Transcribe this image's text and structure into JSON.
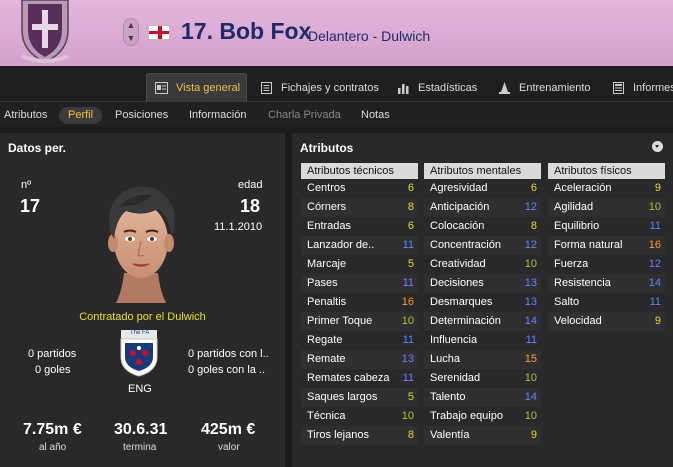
{
  "header": {
    "player_name": "17. Bob Fox",
    "position_club": "Delantero - Dulwich",
    "nation_flag": "england-flag-icon"
  },
  "tabs": [
    {
      "label": "Vista general",
      "icon": "overview-icon",
      "active": true
    },
    {
      "label": "Fichajes y contratos",
      "icon": "document-icon"
    },
    {
      "label": "Estadísticas",
      "icon": "bar-chart-icon"
    },
    {
      "label": "Entrenamiento",
      "icon": "cone-icon"
    },
    {
      "label": "Informes",
      "icon": "report-icon"
    }
  ],
  "subnav": [
    "Atributos",
    "Perfil",
    "Posiciones",
    "Información",
    "Charla Privada",
    "Notas"
  ],
  "subnav_active": "Perfil",
  "personal": {
    "title": "Datos per.",
    "number_label": "nº",
    "number": "17",
    "age_label": "edad",
    "age": "18",
    "dob": "11.1.2010",
    "contract": "Contratado por el Dulwich",
    "left_games": "0 partidos",
    "left_goals": "0 goles",
    "right_games": "0 partidos con l..",
    "right_goals": "0 goles con la ..",
    "fa_text": "The FA",
    "nation_code": "ENG",
    "wage_value": "7.75m €",
    "wage_label": "al año",
    "expires_value": "30.6.31",
    "expires_label": "termina",
    "value_value": "425m €",
    "value_label": "valor"
  },
  "attributes": {
    "title": "Atributos",
    "colors": {
      "green": "#a8c93a",
      "yellow": "#e8d92c",
      "blue": "#6e7fff",
      "orange": "#ff9d2a"
    },
    "technical": {
      "header": "Atributos técnicos",
      "items": [
        {
          "name": "Centros",
          "value": "6",
          "color": "yellow"
        },
        {
          "name": "Córners",
          "value": "8",
          "color": "yellow"
        },
        {
          "name": "Entradas",
          "value": "6",
          "color": "yellow"
        },
        {
          "name": "Lanzador de..",
          "value": "11",
          "color": "blue"
        },
        {
          "name": "Marcaje",
          "value": "5",
          "color": "yellow"
        },
        {
          "name": "Pases",
          "value": "11",
          "color": "blue"
        },
        {
          "name": "Penaltis",
          "value": "16",
          "color": "orange"
        },
        {
          "name": "Primer Toque",
          "value": "10",
          "color": "green"
        },
        {
          "name": "Regate",
          "value": "11",
          "color": "blue"
        },
        {
          "name": "Remate",
          "value": "13",
          "color": "blue"
        },
        {
          "name": "Remates cabeza",
          "value": "11",
          "color": "blue"
        },
        {
          "name": "Saques largos",
          "value": "5",
          "color": "yellow"
        },
        {
          "name": "Técnica",
          "value": "10",
          "color": "green"
        },
        {
          "name": "Tiros lejanos",
          "value": "8",
          "color": "yellow"
        }
      ]
    },
    "mental": {
      "header": "Atributos mentales",
      "items": [
        {
          "name": "Agresividad",
          "value": "6",
          "color": "yellow"
        },
        {
          "name": "Anticipación",
          "value": "12",
          "color": "blue"
        },
        {
          "name": "Colocación",
          "value": "8",
          "color": "yellow"
        },
        {
          "name": "Concentración",
          "value": "12",
          "color": "blue"
        },
        {
          "name": "Creatividad",
          "value": "10",
          "color": "green"
        },
        {
          "name": "Decisiones",
          "value": "13",
          "color": "blue"
        },
        {
          "name": "Desmarques",
          "value": "13",
          "color": "blue"
        },
        {
          "name": "Determinación",
          "value": "14",
          "color": "blue"
        },
        {
          "name": "Influencia",
          "value": "11",
          "color": "blue"
        },
        {
          "name": "Lucha",
          "value": "15",
          "color": "orange"
        },
        {
          "name": "Serenidad",
          "value": "10",
          "color": "green"
        },
        {
          "name": "Talento",
          "value": "14",
          "color": "blue"
        },
        {
          "name": "Trabajo equipo",
          "value": "10",
          "color": "green"
        },
        {
          "name": "Valentía",
          "value": "9",
          "color": "yellow"
        }
      ]
    },
    "physical": {
      "header": "Atributos físicos",
      "items": [
        {
          "name": "Aceleración",
          "value": "9",
          "color": "yellow"
        },
        {
          "name": "Agilidad",
          "value": "10",
          "color": "green"
        },
        {
          "name": "Equilibrio",
          "value": "11",
          "color": "blue"
        },
        {
          "name": "Forma natural",
          "value": "16",
          "color": "orange"
        },
        {
          "name": "Fuerza",
          "value": "12",
          "color": "blue"
        },
        {
          "name": "Resistencia",
          "value": "14",
          "color": "blue"
        },
        {
          "name": "Salto",
          "value": "11",
          "color": "blue"
        },
        {
          "name": "Velocidad",
          "value": "9",
          "color": "yellow"
        }
      ]
    }
  }
}
